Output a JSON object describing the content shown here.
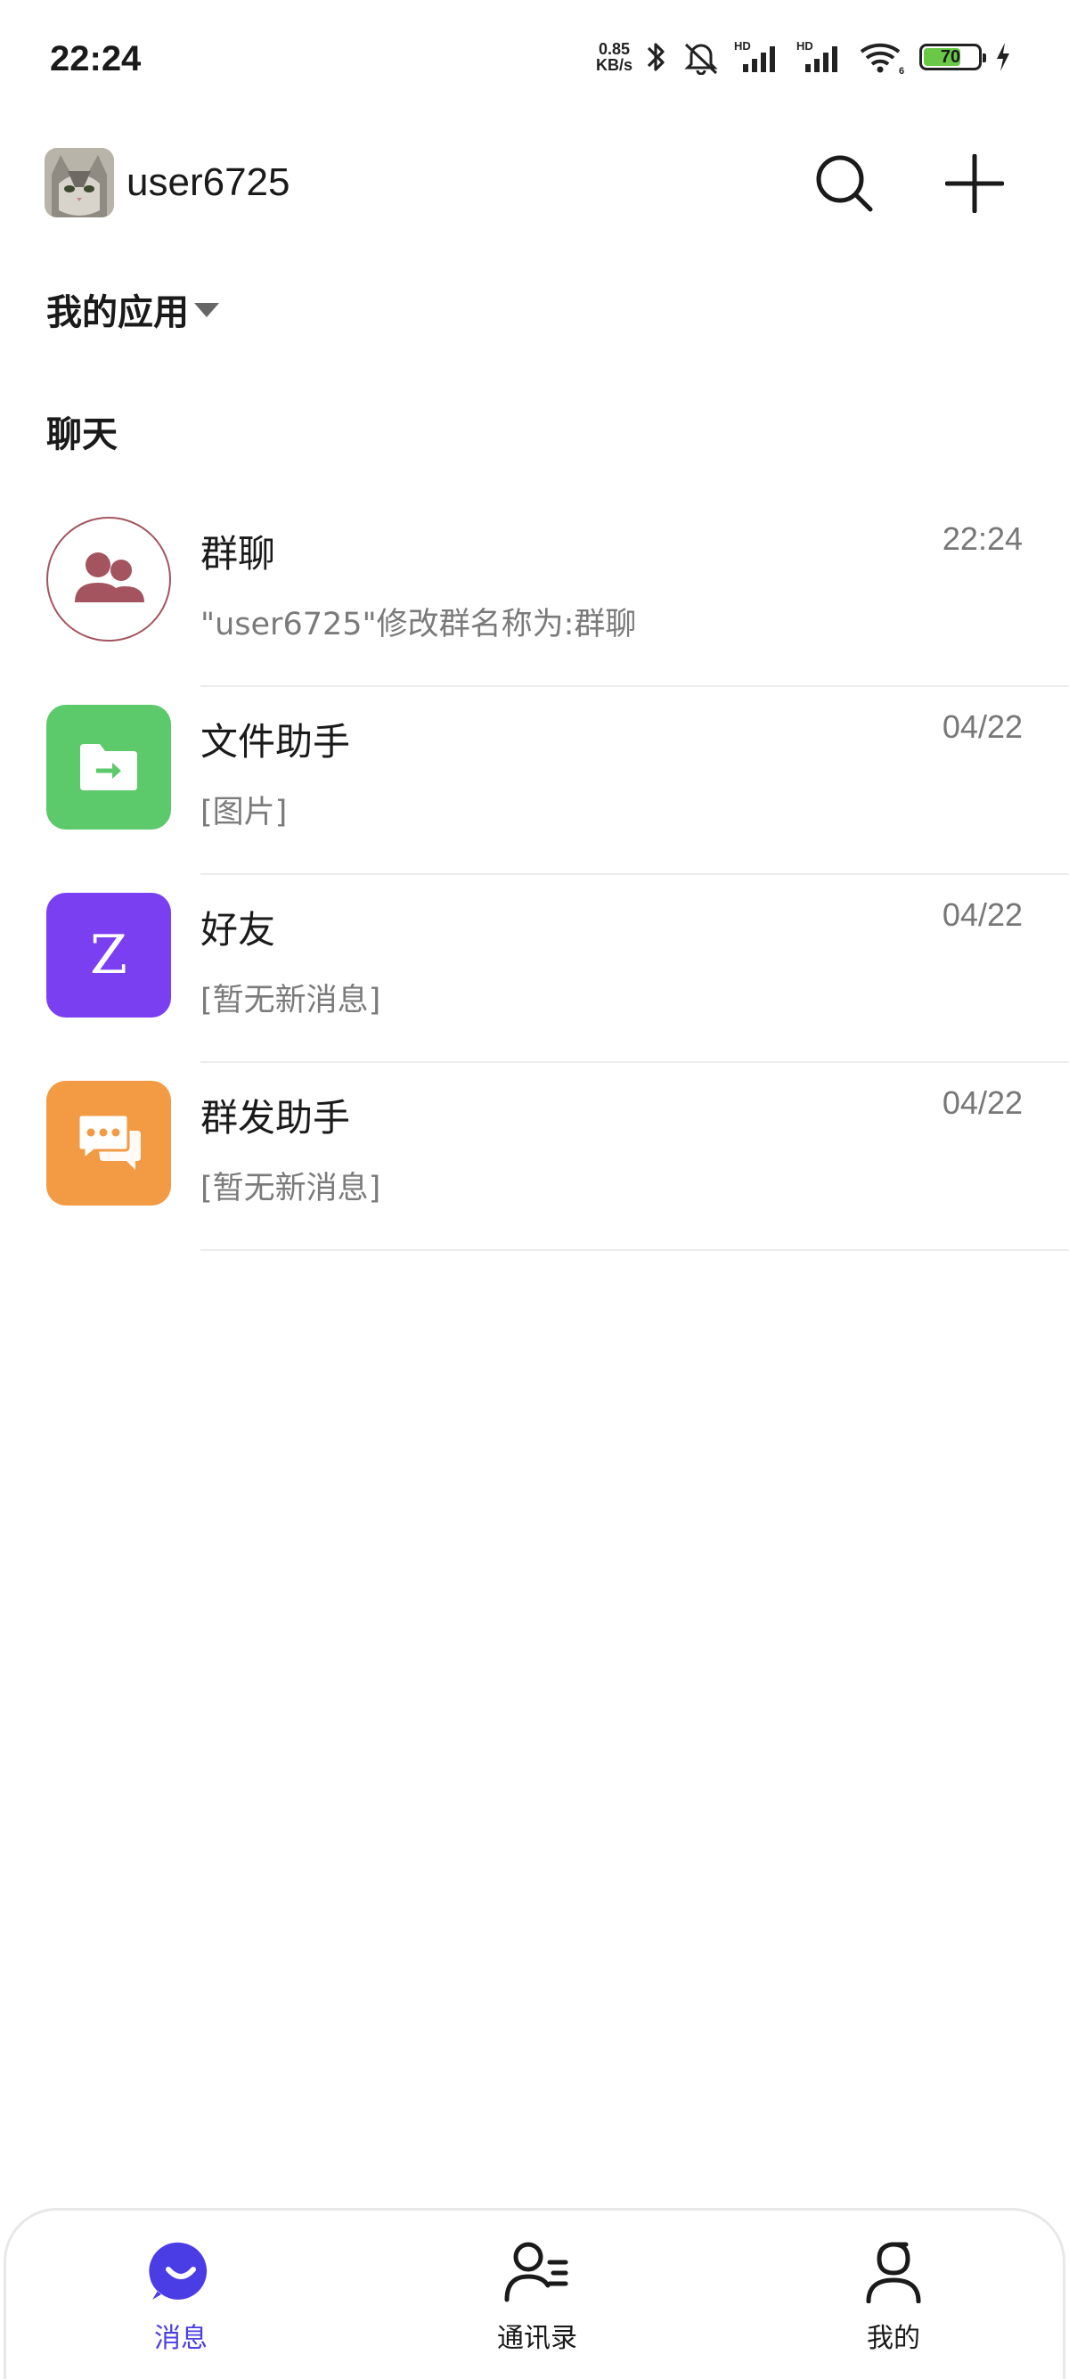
{
  "status_bar": {
    "time": "22:24",
    "net_speed_value": "0.85",
    "net_speed_unit": "KB/s",
    "battery": "70",
    "battery_level": 0.7,
    "signal_label": "HD",
    "wifi_label": "6",
    "icons": [
      "bluetooth-icon",
      "mute-icon",
      "signal-hd-icon",
      "signal-hd-icon",
      "wifi-icon",
      "battery-icon",
      "charging-icon"
    ]
  },
  "header": {
    "username": "user6725",
    "search_icon": "search-icon",
    "add_icon": "plus-icon"
  },
  "sections": {
    "apps_label": "我的应用",
    "chat_label": "聊天"
  },
  "chats": [
    {
      "name": "群聊",
      "time": "22:24",
      "preview": "\"user6725\"修改群名称为:群聊",
      "icon": "group-icon",
      "color": "#a4545e"
    },
    {
      "name": "文件助手",
      "time": "04/22",
      "preview": "[图片]",
      "icon": "folder-icon",
      "color": "#5cc96a"
    },
    {
      "name": "好友",
      "time": "04/22",
      "preview": "[暂无新消息]",
      "icon": "letter-z-icon",
      "letter": "Z",
      "color": "#7b3ff2"
    },
    {
      "name": "群发助手",
      "time": "04/22",
      "preview": "[暂无新消息]",
      "icon": "broadcast-chat-icon",
      "color": "#f29a44"
    }
  ],
  "bottom_nav": [
    {
      "label": "消息",
      "icon": "message-icon",
      "active": true
    },
    {
      "label": "通讯录",
      "icon": "contacts-icon",
      "active": false
    },
    {
      "label": "我的",
      "icon": "profile-icon",
      "active": false
    }
  ],
  "colors": {
    "accent": "#4b3de6",
    "divider": "#ececec"
  }
}
